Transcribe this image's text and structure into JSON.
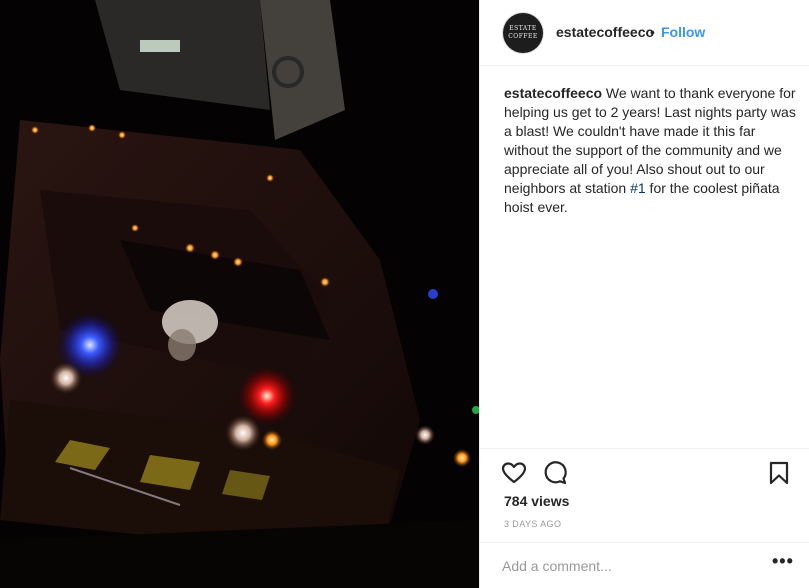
{
  "post": {
    "media_alt": "Fire truck at night with red and blue emergency lights"
  },
  "header": {
    "avatar_text": "ESTATE COFFEE",
    "username": "estatecoffeeco",
    "separator": "•",
    "follow_label": "Follow"
  },
  "caption": {
    "username": "estatecoffeeco",
    "text_before": " We want to thank everyone for helping us get to 2 years! Last nights party was a blast! We couldn't have made it this far without the support of the community and we appreciate all of you! Also shout out to our neighbors at station ",
    "hashtag": "#1",
    "text_after": " for the coolest piñata hoist ever."
  },
  "actions": {
    "like_icon": "heart-icon",
    "comment_icon": "comment-icon",
    "save_icon": "bookmark-icon"
  },
  "stats": {
    "views": "784 views",
    "time": "3 DAYS AGO"
  },
  "comment": {
    "placeholder": "Add a comment...",
    "more_label": "•••"
  }
}
